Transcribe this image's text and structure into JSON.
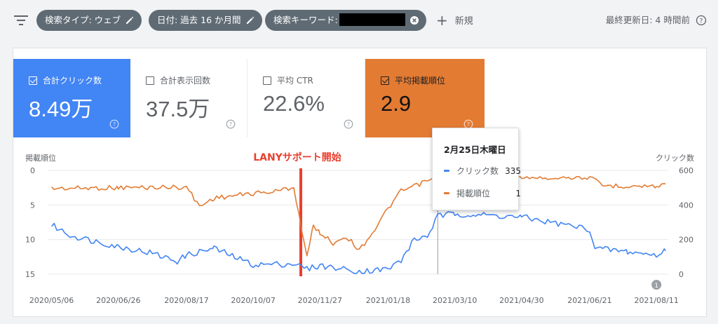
{
  "toolbar": {
    "chips": [
      {
        "label": "検索タイプ: ウェブ",
        "icon": "pencil-icon"
      },
      {
        "label": "日付: 過去 16 か月間",
        "icon": "pencil-icon"
      },
      {
        "label": "検索キーワード:",
        "icon": "close-circle-icon"
      }
    ],
    "new_label": "新規",
    "last_updated": "最終更新日: 4 時間前"
  },
  "metrics": [
    {
      "label": "合計クリック数",
      "value": "8.49万",
      "checked": true,
      "color": "#4285f4"
    },
    {
      "label": "合計表示回数",
      "value": "37.5万",
      "checked": false
    },
    {
      "label": "平均 CTR",
      "value": "22.6%",
      "checked": false
    },
    {
      "label": "平均掲載順位",
      "value": "2.9",
      "checked": true,
      "color": "#e37b33"
    }
  ],
  "annotation": {
    "text": "LANYサポート開始",
    "color": "#e8402f"
  },
  "tooltip": {
    "date": "2月25日木曜日",
    "rows": [
      {
        "label": "クリック数",
        "value": "335",
        "color": "#4285f4"
      },
      {
        "label": "掲載順位",
        "value": "1",
        "color": "#e37b33"
      }
    ]
  },
  "chart_data": {
    "type": "line",
    "left_axis_label": "掲載順位",
    "right_axis_label": "クリック数",
    "left_ticks": [
      "0",
      "5",
      "10",
      "15"
    ],
    "right_ticks": [
      "600",
      "400",
      "200",
      "0"
    ],
    "left_range": [
      15,
      0
    ],
    "right_range": [
      0,
      600
    ],
    "x_labels": [
      "2020/05/06",
      "2020/06/26",
      "2020/08/17",
      "2020/10/07",
      "2020/11/27",
      "2021/01/18",
      "2021/03/10",
      "2021/04/30",
      "2021/06/21",
      "2021/08/11"
    ],
    "marker_badge": "1",
    "series": [
      {
        "name": "掲載順位",
        "axis": "left",
        "color": "#e37b33",
        "x": [
          "2020/05/06",
          "2020/06/26",
          "2020/08/17",
          "2020/08/27",
          "2020/09/07",
          "2020/10/07",
          "2020/10/22",
          "2020/11/07",
          "2020/11/17",
          "2020/11/22",
          "2020/11/27",
          "2020/12/07",
          "2020/12/17",
          "2020/12/27",
          "2021/01/08",
          "2021/01/18",
          "2021/01/28",
          "2021/02/07",
          "2021/02/17",
          "2021/02/25",
          "2021/03/10",
          "2021/04/30",
          "2021/06/21",
          "2021/07/01",
          "2021/08/11",
          "2021/08/18"
        ],
        "y": [
          2.6,
          2.5,
          2.4,
          5.2,
          4.0,
          3.3,
          3.1,
          2.4,
          12.5,
          8.0,
          9.0,
          10.5,
          9.5,
          11.5,
          8.5,
          5.5,
          3.0,
          2.3,
          1.5,
          1.0,
          1.0,
          1.0,
          1.0,
          2.2,
          2.3,
          2.0
        ]
      },
      {
        "name": "クリック数",
        "axis": "right",
        "color": "#4285f4",
        "x": [
          "2020/05/06",
          "2020/05/20",
          "2020/06/26",
          "2020/07/20",
          "2020/08/10",
          "2020/08/17",
          "2020/09/07",
          "2020/10/07",
          "2020/11/07",
          "2020/11/17",
          "2020/11/27",
          "2020/12/27",
          "2021/01/18",
          "2021/01/28",
          "2021/02/07",
          "2021/02/17",
          "2021/02/25",
          "2021/03/10",
          "2021/04/30",
          "2021/06/21",
          "2021/06/25",
          "2021/07/20",
          "2021/08/11",
          "2021/08/18"
        ],
        "y": [
          285,
          225,
          160,
          125,
          75,
          110,
          150,
          55,
          60,
          30,
          50,
          15,
          30,
          80,
          200,
          220,
          335,
          350,
          330,
          260,
          150,
          130,
          110,
          135
        ]
      }
    ]
  }
}
